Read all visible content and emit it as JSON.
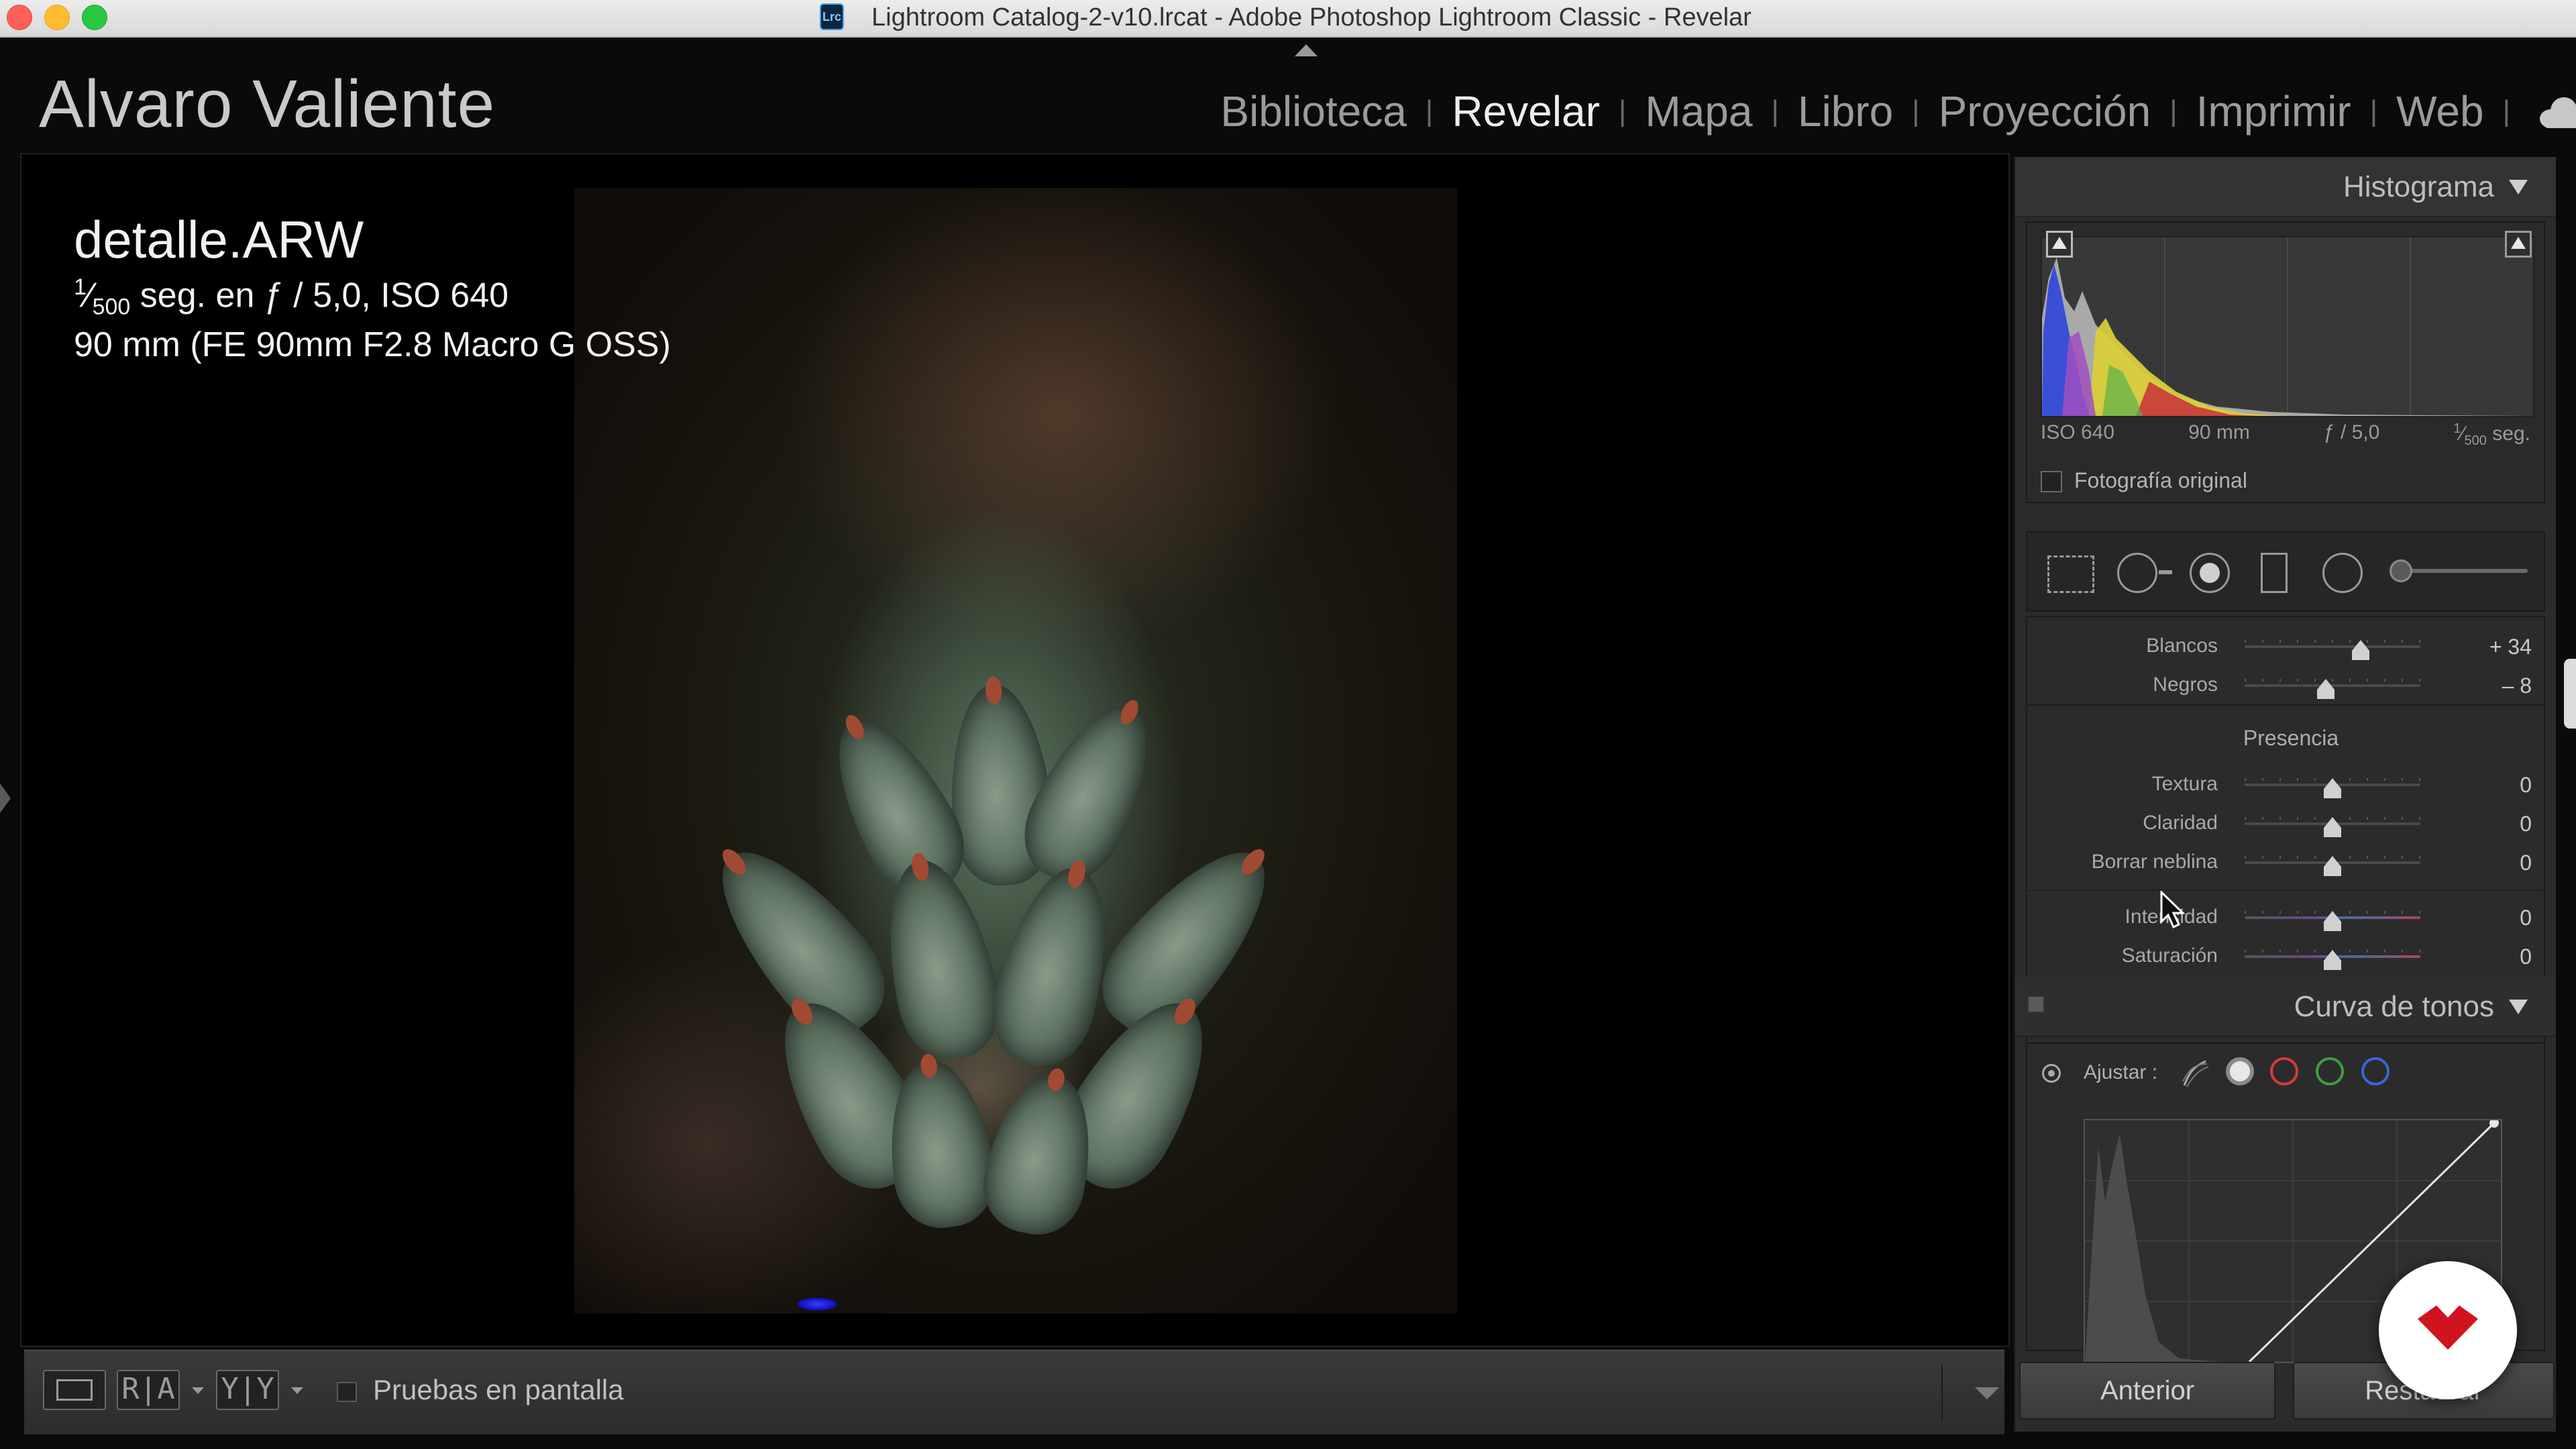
{
  "window": {
    "title": "Lightroom Catalog-2-v10.lrcat - Adobe Photoshop Lightroom Classic - Revelar",
    "app_icon_label": "Lrc"
  },
  "identity_plate": "Alvaro Valiente",
  "modules": [
    {
      "label": "Biblioteca",
      "active": false
    },
    {
      "label": "Revelar",
      "active": true
    },
    {
      "label": "Mapa",
      "active": false
    },
    {
      "label": "Libro",
      "active": false
    },
    {
      "label": "Proyección",
      "active": false
    },
    {
      "label": "Imprimir",
      "active": false
    },
    {
      "label": "Web",
      "active": false
    }
  ],
  "module_separator": "|",
  "info_overlay": {
    "filename": "detalle.ARW",
    "shutter_numerator": "1",
    "shutter_denominator": "500",
    "line1_rest": " seg. en ƒ / 5,0, ISO 640",
    "line2": "90 mm (FE 90mm F2.8 Macro G OSS)"
  },
  "toolbar": {
    "compare_ra": "R|A",
    "compare_yy": "Y|Y",
    "soft_proofing_label": "Pruebas en pantalla",
    "soft_proofing_checked": false
  },
  "histogram": {
    "title": "Histograma",
    "iso": "ISO 640",
    "focal": "90 mm",
    "aperture": "ƒ / 5,0",
    "shutter_num": "1",
    "shutter_den": "500",
    "shutter_suffix": " seg.",
    "original_photo_label": "Fotografía original",
    "original_photo_checked": false
  },
  "basic": {
    "sliders_top": [
      {
        "label": "Blancos",
        "value": "+ 34",
        "position": 0.66
      },
      {
        "label": "Negros",
        "value": "– 8",
        "position": 0.46
      }
    ],
    "presence_title": "Presencia",
    "presence_sliders": [
      {
        "label": "Textura",
        "value": "0",
        "position": 0.5,
        "rainbow": false
      },
      {
        "label": "Claridad",
        "value": "0",
        "position": 0.5,
        "rainbow": false
      },
      {
        "label": "Borrar neblina",
        "value": "0",
        "position": 0.5,
        "rainbow": false
      },
      {
        "label": "Intensidad",
        "value": "0",
        "position": 0.5,
        "rainbow": true
      },
      {
        "label": "Saturación",
        "value": "0",
        "position": 0.5,
        "rainbow": true
      }
    ]
  },
  "tone_curve": {
    "title": "Curva de tonos",
    "adjust_label": "Ajustar :"
  },
  "buttons": {
    "previous": "Anterior",
    "reset": "Restaurar"
  },
  "colors": {
    "red_channel": "#d83a3a",
    "green_channel": "#3aa040",
    "blue_channel": "#3a66d8"
  }
}
